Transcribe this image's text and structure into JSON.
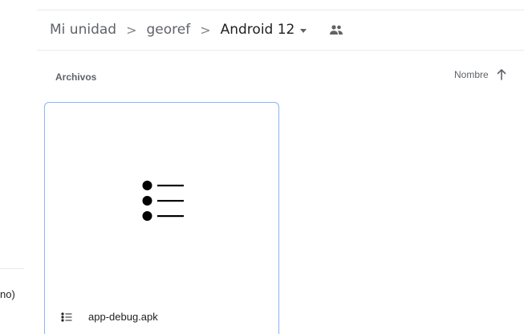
{
  "breadcrumb": {
    "items": [
      "Mi unidad",
      "georef",
      "Android 12"
    ],
    "separator": ">"
  },
  "section": {
    "label": "Archivos"
  },
  "sort": {
    "label": "Nombre",
    "direction_icon": "arrow-up-icon"
  },
  "files": [
    {
      "name": "app-debug.apk",
      "icon": "list-bullets-icon"
    }
  ],
  "sidebar_partial_text": "no)",
  "colors": {
    "selection_border": "#8ab4f8",
    "text_secondary": "#5f6368",
    "text_primary": "#202124",
    "divider": "#e8eaed"
  }
}
